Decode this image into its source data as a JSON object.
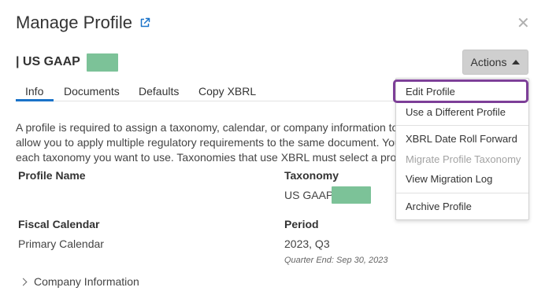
{
  "dialog": {
    "title": "Manage Profile",
    "profile_name": "| US GAAP",
    "actions_label": "Actions"
  },
  "tabs": [
    {
      "label": "Info",
      "active": true
    },
    {
      "label": "Documents",
      "active": false
    },
    {
      "label": "Defaults",
      "active": false
    },
    {
      "label": "Copy XBRL",
      "active": false
    }
  ],
  "description": {
    "line1": "A profile is required to assign a taxonomy, calendar, or company information to y",
    "line2": "allow you to apply multiple regulatory requirements to the same document. You",
    "line3": "each taxonomy you want to use. Taxonomies that use XBRL must select a profile"
  },
  "fields": {
    "profile_name_label": "Profile Name",
    "taxonomy_label": "Taxonomy",
    "taxonomy_value": "US GAAP",
    "fiscal_calendar_label": "Fiscal Calendar",
    "fiscal_calendar_value": "Primary Calendar",
    "period_label": "Period",
    "period_value": "2023, Q3",
    "quarter_end": "Quarter End: Sep 30, 2023"
  },
  "company_section": {
    "label": "Company Information"
  },
  "actions_menu": {
    "items": [
      {
        "label": "Edit Profile",
        "disabled": false
      },
      {
        "label": "Use a Different Profile",
        "disabled": false
      },
      {
        "label": "XBRL Date Roll Forward",
        "disabled": false
      },
      {
        "label": "Migrate Profile Taxonomy",
        "disabled": true
      },
      {
        "label": "View Migration Log",
        "disabled": false
      },
      {
        "label": "Archive Profile",
        "disabled": false
      }
    ]
  },
  "colors": {
    "accent": "#1a73c9",
    "highlight": "#7d3f98",
    "redaction": "#7cc298",
    "button_bg": "#cfcfcf"
  },
  "icons": {
    "external_link": "external-link-icon",
    "close": "close-icon",
    "caret": "caret-up-icon",
    "chevron": "chevron-right-icon"
  }
}
